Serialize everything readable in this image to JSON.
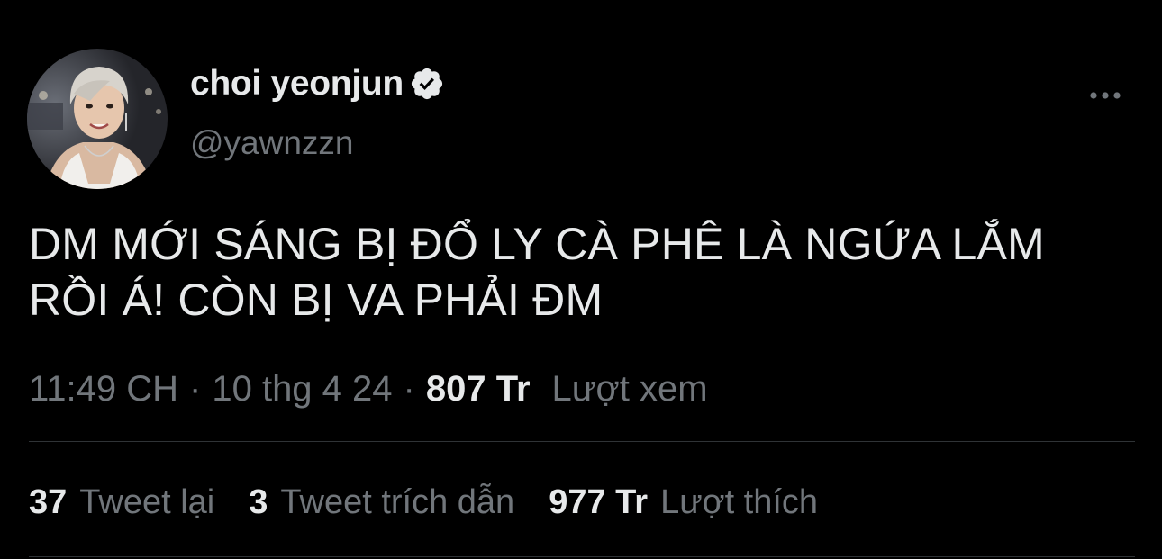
{
  "author": {
    "display_name": "choi yeonjun",
    "handle": "@yawnzzn",
    "verified": true
  },
  "tweet": {
    "text_line1": "DM MỚI SÁNG BỊ ĐỔ LY CÀ PHÊ LÀ NGỨA LẮM",
    "text_line2": "RỒI Á! CÒN BỊ VA PHẢI ĐM"
  },
  "meta": {
    "time": "11:49 CH",
    "separator": "·",
    "date": "10 thg 4 24",
    "views_count": "807 Tr",
    "views_label": "Lượt xem"
  },
  "stats": {
    "retweets_count": "37",
    "retweets_label": "Tweet lại",
    "quotes_count": "3",
    "quotes_label": "Tweet trích dẫn",
    "likes_count": "977 Tr",
    "likes_label": "Lượt thích"
  },
  "icons": {
    "verified": "verified-badge-icon",
    "more": "more-options-icon"
  },
  "colors": {
    "background": "#000000",
    "primary_text": "#e7e9ea",
    "secondary_text": "#71767b",
    "divider": "#2f3336",
    "verified_badge": "#e7e9ea"
  }
}
